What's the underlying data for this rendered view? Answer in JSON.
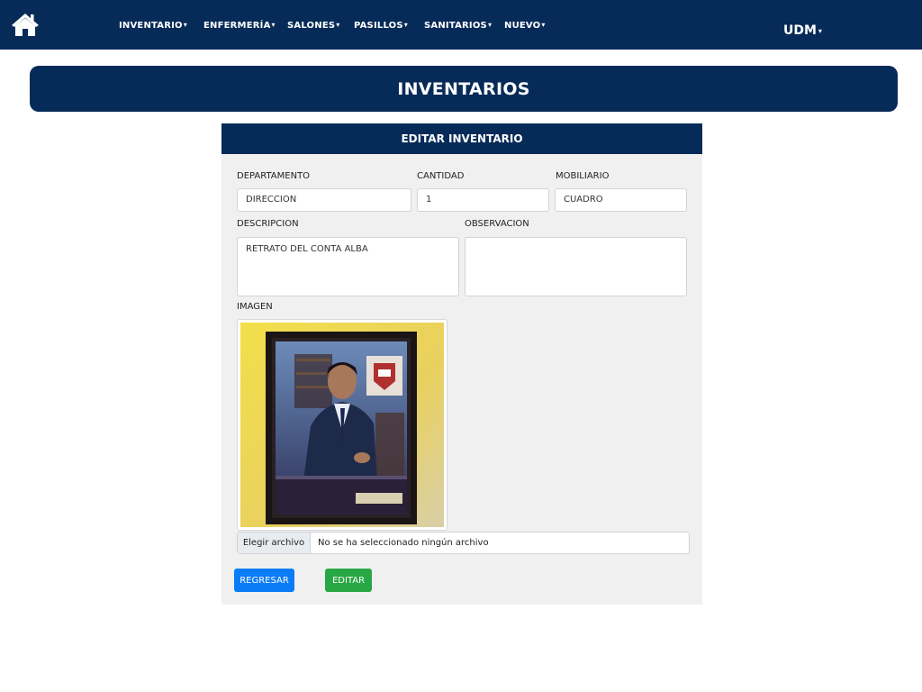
{
  "nav": {
    "home_icon": "home-icon",
    "items": [
      {
        "label": "INVENTARIO",
        "caret": "▾"
      },
      {
        "label": "ENFERMERÍA",
        "caret": "▾"
      },
      {
        "label": "SALONES",
        "caret": "▾"
      },
      {
        "label": "PASILLOS",
        "caret": "▾"
      },
      {
        "label": "SANITARIOS",
        "caret": "▾"
      },
      {
        "label": "NUEVO",
        "caret": "▾"
      }
    ],
    "user": {
      "label": "UDM",
      "caret": "▾"
    }
  },
  "banner": {
    "title": "INVENTARIOS"
  },
  "form": {
    "title": "EDITAR INVENTARIO",
    "departamento": {
      "label": "DEPARTAMENTO",
      "value": "DIRECCION"
    },
    "cantidad": {
      "label": "CANTIDAD",
      "value": "1"
    },
    "mobiliario": {
      "label": "MOBILIARIO",
      "value": "CUADRO"
    },
    "descripcion": {
      "label": "DESCRIPCION",
      "value": "RETRATO DEL CONTA ALBA"
    },
    "observacion": {
      "label": "OBSERVACION",
      "value": ""
    },
    "imagen": {
      "label": "IMAGEN"
    },
    "file": {
      "button_label": "Elegir archivo",
      "status": "No se ha seleccionado ningún archivo"
    },
    "buttons": {
      "back": "REGRESAR",
      "edit": "EDITAR"
    }
  },
  "colors": {
    "navy": "#072b58",
    "blue": "#0a7cf5",
    "green": "#28a745",
    "card_bg": "#f0f0f0"
  }
}
